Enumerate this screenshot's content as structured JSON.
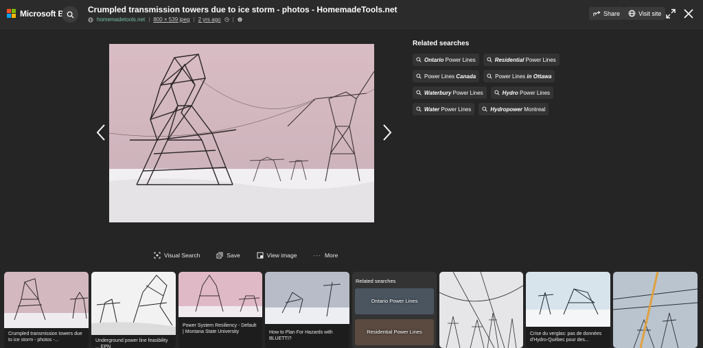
{
  "app": {
    "brand": "Microsoft Bing"
  },
  "header": {
    "title": "Crumpled transmission towers due to ice storm - photos - HomemadeTools.net",
    "domain": "homemadetools.net",
    "dimensions": "800 × 539 jpeg",
    "age": "2 yrs ago",
    "share_label": "Share",
    "visit_label": "Visit site"
  },
  "related": {
    "title": "Related searches",
    "rows": [
      [
        {
          "bold": "Ontario",
          "rest": " Power Lines",
          "pre": ""
        },
        {
          "bold": "Residential",
          "rest": " Power Lines",
          "pre": ""
        }
      ],
      [
        {
          "pre": "Power Lines ",
          "bold": "Canada",
          "rest": ""
        },
        {
          "pre": "Power Lines ",
          "bold": "in Ottawa",
          "rest": ""
        }
      ],
      [
        {
          "bold": "Waterbury",
          "rest": " Power Lines",
          "pre": ""
        },
        {
          "bold": "Hydro",
          "rest": " Power Lines",
          "pre": ""
        }
      ],
      [
        {
          "bold": "Water",
          "rest": " Power Lines",
          "pre": ""
        },
        {
          "bold": "Hydropower",
          "rest": " Montreal",
          "pre": ""
        }
      ]
    ]
  },
  "actions": {
    "visual_search": "Visual Search",
    "save": "Save",
    "view_image": "View image",
    "more": "More"
  },
  "strip": {
    "cards": [
      {
        "caption": "Crumpled transmission towers due to ice storm - photos -..."
      },
      {
        "caption": "Underground power line feasibility ... EPN"
      },
      {
        "caption": "Power System Resiliency - Default | Montana State University"
      },
      {
        "caption": "How to Plan For Hazards with BLUETTI?"
      },
      {
        "caption": "Crise du verglas: pas de données d'Hydro-Québec pour des..."
      }
    ],
    "related": {
      "title": "Related searches",
      "tile1": "Ontario Power Lines",
      "tile2": "Residential Power Lines"
    }
  },
  "colors": {
    "background": "#252526",
    "topbar": "#2b2b2b",
    "chip": "#333333",
    "domain_green": "#78c0a8"
  }
}
